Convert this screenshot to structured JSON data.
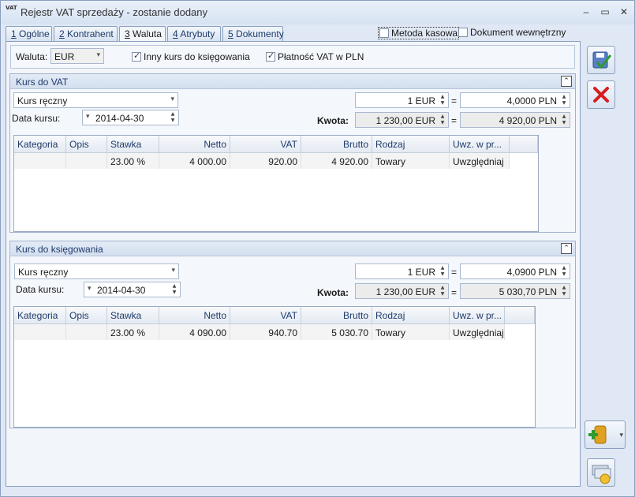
{
  "window": {
    "title": "Rejestr VAT sprzedaży - zostanie dodany",
    "icon": "vat-app-icon",
    "icon_text": "VAT"
  },
  "tabs": [
    {
      "num": "1",
      "label": " Ogólne"
    },
    {
      "num": "2",
      "label": " Kontrahent"
    },
    {
      "num": "3",
      "label": " Waluta"
    },
    {
      "num": "4",
      "label": " Atrybuty"
    },
    {
      "num": "5",
      "label": " Dokumenty"
    }
  ],
  "top_checks": {
    "metoda": "Metoda kasowa",
    "dokument": "Dokument wewnętrzny"
  },
  "currency_row": {
    "label": "Waluta:",
    "value": "EUR",
    "inny_kurs": "Inny kurs do księgowania",
    "platnosc": "Płatność VAT w PLN"
  },
  "columns": [
    "Kategoria",
    "Opis",
    "Stawka",
    "Netto",
    "VAT",
    "Brutto",
    "Rodzaj",
    "Uwz. w pr..."
  ],
  "vat_section": {
    "title": "Kurs do VAT",
    "kurs_type": "Kurs ręczny",
    "data_label": "Data kursu:",
    "date": "2014-04-30",
    "eur_amount": "1 EUR",
    "eq": "=",
    "pln_rate": "4,0000 PLN",
    "kwota_label": "Kwota:",
    "kwota_eur": "1 230,00 EUR",
    "kwota_pln": "4 920,00 PLN",
    "row": {
      "kategoria": "",
      "opis": "",
      "stawka": "23.00 %",
      "netto": "4 000.00",
      "vat": "920.00",
      "brutto": "4 920.00",
      "rodzaj": "Towary",
      "uwz": "Uwzględniaj"
    }
  },
  "ks_section": {
    "title": "Kurs do księgowania",
    "kurs_type": "Kurs ręczny",
    "data_label": "Data kursu:",
    "date": "2014-04-30",
    "eur_amount": "1 EUR",
    "eq": "=",
    "pln_rate": "4,0900 PLN",
    "kwota_label": "Kwota:",
    "kwota_eur": "1 230,00 EUR",
    "kwota_pln": "5 030,70 PLN",
    "row": {
      "kategoria": "",
      "opis": "",
      "stawka": "23.00 %",
      "netto": "4 090.00",
      "vat": "940.70",
      "brutto": "5 030.70",
      "rodzaj": "Towary",
      "uwz": "Uwzględniaj"
    }
  },
  "icons": {
    "save": "save-icon",
    "cancel": "cancel-icon",
    "add": "add-document-icon",
    "payments": "payments-icon"
  },
  "colors": {
    "title_text": "#1e3a6a",
    "cancel_red": "#d81e1e",
    "add_green": "#2e9b2e"
  }
}
